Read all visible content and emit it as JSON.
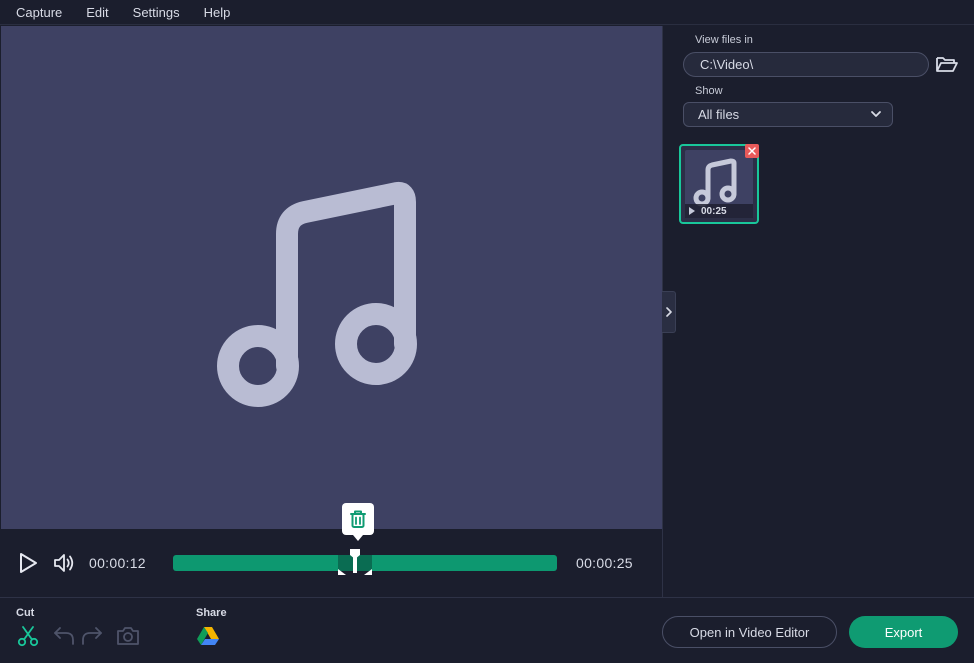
{
  "menu": {
    "items": [
      {
        "label": "Capture"
      },
      {
        "label": "Edit"
      },
      {
        "label": "Settings"
      },
      {
        "label": "Help"
      }
    ]
  },
  "preview": {
    "icon": "music-note-icon"
  },
  "player": {
    "current_time": "00:00:12",
    "total_time": "00:00:25",
    "progress": 0.48
  },
  "files": {
    "view_label": "View files in",
    "path": "C:\\Video\\",
    "show_label": "Show",
    "filter_value": "All files",
    "items": [
      {
        "duration": "00:25",
        "icon": "music-note-icon"
      }
    ]
  },
  "toolbar": {
    "cut_label": "Cut",
    "share_label": "Share",
    "open_editor_label": "Open in Video Editor",
    "export_label": "Export"
  },
  "colors": {
    "accent": "#0f9b72",
    "background": "#1b1e2d",
    "preview_bg": "#3e4163",
    "remove": "#e85a5a"
  }
}
